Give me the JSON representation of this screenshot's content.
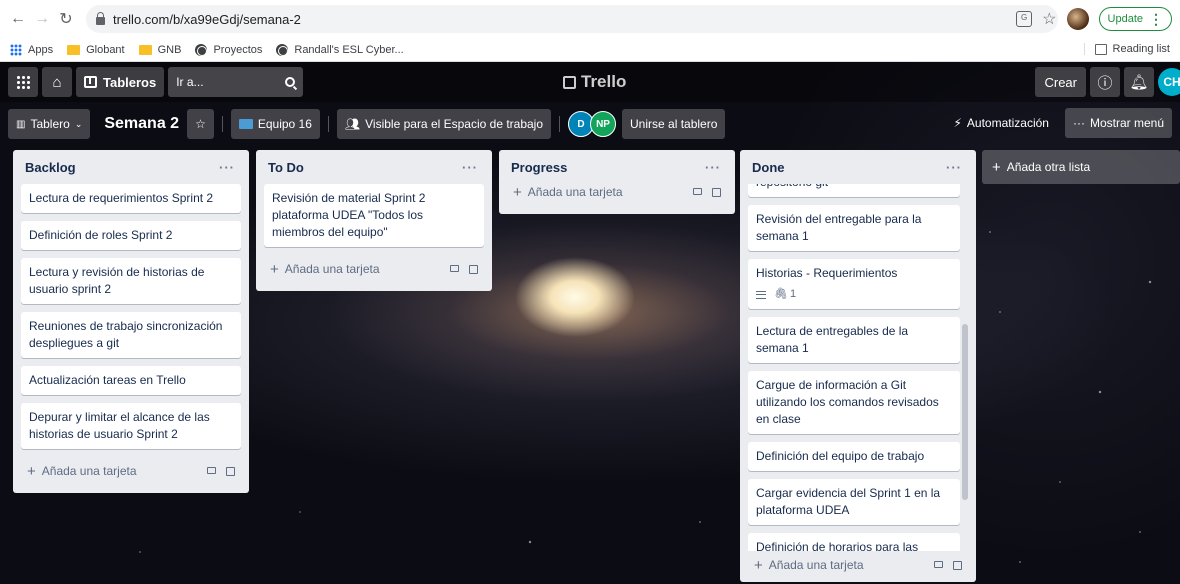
{
  "browser": {
    "url": "trello.com/b/xa99eGdj/semana-2",
    "update_label": "Update",
    "bookmarks": [
      "Apps",
      "Globant",
      "GNB",
      "Proyectos",
      "Randall's ESL Cyber..."
    ],
    "reading_list": "Reading list"
  },
  "topbar": {
    "boards_label": "Tableros",
    "search_placeholder": "Ir a...",
    "logo": "Trello",
    "create_label": "Crear",
    "user_initials": "CH"
  },
  "board": {
    "view_label": "Tablero",
    "title": "Semana 2",
    "team_label": "Equipo 16",
    "visibility_label": "Visible para el Espacio de trabajo",
    "members": [
      "D",
      "NP"
    ],
    "join_label": "Unirse al tablero",
    "automation_label": "Automatización",
    "menu_label": "Mostrar menú",
    "add_list_label": "Añada otra lista"
  },
  "lists": [
    {
      "name": "Backlog",
      "cards": [
        "Lectura de requerimientos Sprint 2",
        "Definición de roles Sprint 2",
        "Lectura y revisión de historias de usuario sprint 2",
        "Reuniones de trabajo sincronización despliegues a git",
        "Actualización tareas en Trello",
        "Depurar y limitar el alcance de las historias de usuario Sprint 2"
      ]
    },
    {
      "name": "To Do",
      "cards": [
        "Revisión de material Sprint 2 plataforma UDEA \"Todos los miembros del equipo\""
      ]
    },
    {
      "name": "Progress",
      "cards": []
    },
    {
      "name": "Done",
      "cards": [
        "repositorio git",
        "Revisión del entregable para la semana 1",
        "Historias - Requerimientos",
        "Lectura de entregables de la semana 1",
        "Cargue de información a Git utilizando los comandos revisados en clase",
        "Definición del equipo de trabajo",
        "Cargar evidencia del Sprint 1 en la plataforma UDEA",
        "Definición de horarios para las reuniones durante Daily"
      ],
      "attachment_count": "1"
    }
  ],
  "add_card_label": "Añada una tarjeta"
}
